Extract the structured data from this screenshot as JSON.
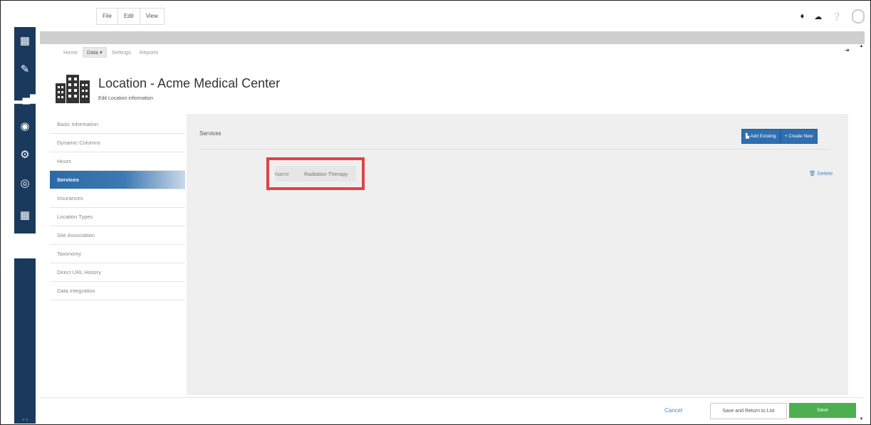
{
  "menubar": {
    "items": [
      "File",
      "Edit",
      "View"
    ]
  },
  "top_icons": [
    "bell-icon",
    "cloud-icon",
    "help-icon",
    "user-avatar"
  ],
  "left_nav": {
    "icons": [
      "dashboard-icon",
      "edit-icon",
      "bar-chart-icon",
      "settings-circle-icon",
      "gear-icon",
      "tools-circle-icon",
      "grid-icon"
    ],
    "footer": "» »"
  },
  "tabs": {
    "home": "Home",
    "data": "Data ▾",
    "settings": "Settings",
    "reports": "Reports"
  },
  "header": {
    "title": "Location - Acme Medical Center",
    "subtitle": "Edit Location information"
  },
  "side_menu": [
    "Basic Information",
    "Dynamic Columns",
    "Hours",
    "Services",
    "Insurances",
    "Location Types",
    "Site Association",
    "Taxonomy",
    "Direct URL History",
    "Data Integration"
  ],
  "active_side_item": "Services",
  "panel": {
    "title": "Services",
    "add_existing": "▙ Add Existing",
    "create_new": "+ Create New",
    "service": {
      "label": "Name",
      "value": "Radiation Therapy"
    },
    "delete": "🗑 Delete"
  },
  "footer": {
    "cancel": "Cancel",
    "save_return": "Save and Return to List",
    "save": "Save"
  },
  "colors": {
    "nav_bg": "#193a5c",
    "accent_blue": "#2f6fb0",
    "save_green": "#4caf50",
    "highlight_red": "#e04444"
  }
}
